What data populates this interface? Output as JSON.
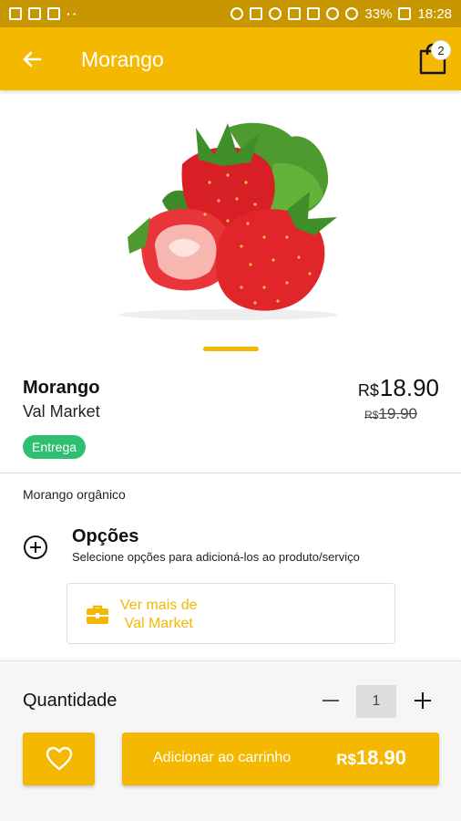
{
  "status_bar": {
    "battery": "33%",
    "time": "18:28"
  },
  "header": {
    "title": "Morango",
    "cart_count": "2"
  },
  "colors": {
    "accent": "#f5b800",
    "status_bar": "#c89700",
    "badge_green": "#2fbf71"
  },
  "product": {
    "name": "Morango",
    "store": "Val Market",
    "currency": "R$",
    "price": "18.90",
    "old_price": "19.90",
    "delivery_badge": "Entrega",
    "description": "Morango orgânico",
    "image_icon": "strawberry-image"
  },
  "options": {
    "title": "Opções",
    "subtitle": "Selecione opções para adicioná-los ao produto/serviço"
  },
  "store_link": {
    "line1": "Ver mais de",
    "line2": "Val Market"
  },
  "bottom_bar": {
    "quantity_label": "Quantidade",
    "quantity_value": "1",
    "add_label": "Adicionar ao carrinho",
    "currency": "R$",
    "add_price": "18.90"
  }
}
